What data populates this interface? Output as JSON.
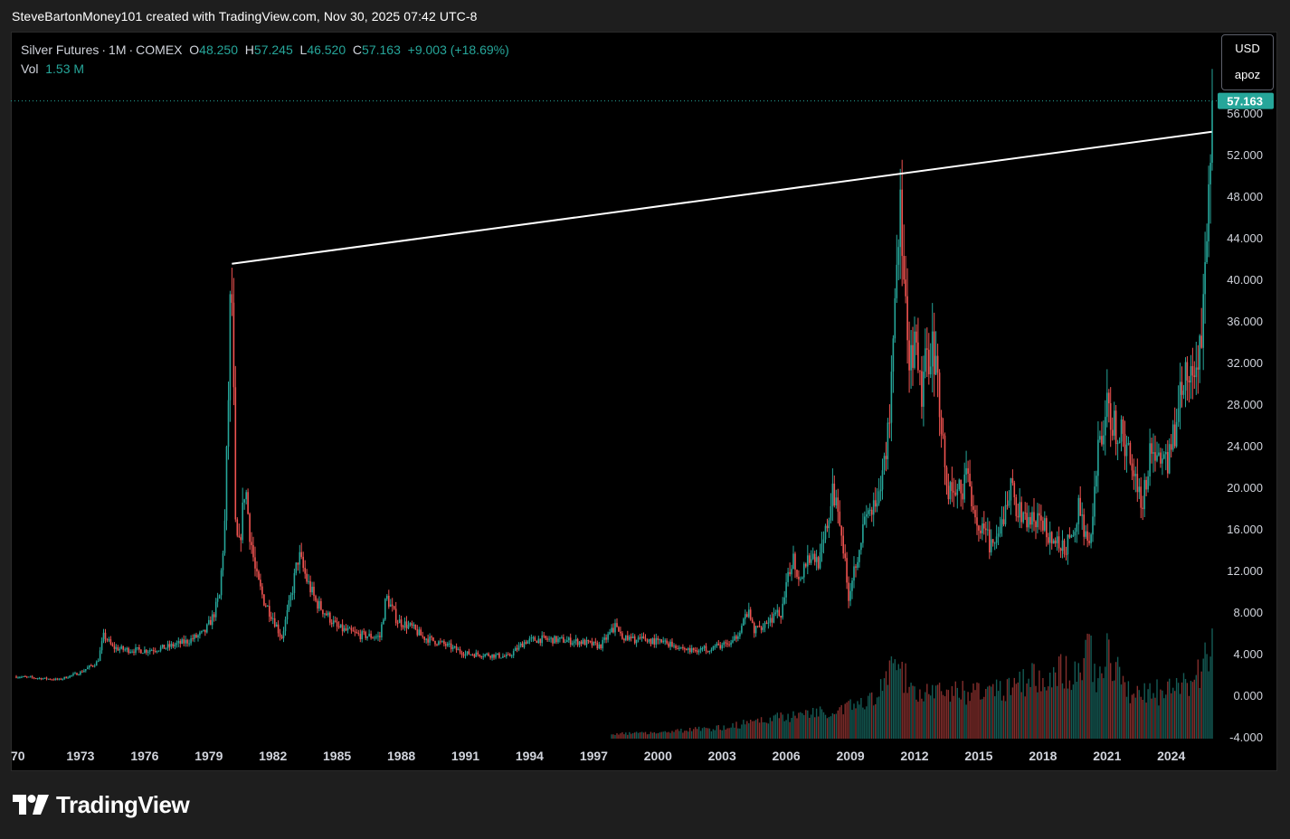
{
  "header": {
    "attribution": "SteveBartonMoney101 created with TradingView.com, Nov 30, 2025 07:42 UTC-8"
  },
  "legend": {
    "symbol": "Silver Futures",
    "interval": "1M",
    "exchange": "COMEX",
    "open_label": "O",
    "open": "48.250",
    "high_label": "H",
    "high": "57.245",
    "low_label": "L",
    "low": "46.520",
    "close_label": "C",
    "close": "57.163",
    "change": "+9.003",
    "change_pct": "(+18.69%)",
    "volume_label": "Vol",
    "volume": "1.53 M"
  },
  "price_scale": {
    "currency": "USD",
    "unit": "apoz",
    "last_price_label": "57.163"
  },
  "branding": {
    "logo_text": "TradingView"
  },
  "colors": {
    "up": "#26a69a",
    "down": "#ef5350",
    "background": "#000000",
    "trendline": "#ffffff",
    "axis_text": "#d1d4dc"
  },
  "chart_data": {
    "type": "candlestick",
    "interval": "1M",
    "y_ticks": [
      "-4.000",
      "0.000",
      "4.000",
      "8.000",
      "12.000",
      "16.000",
      "20.000",
      "24.000",
      "28.000",
      "32.000",
      "36.000",
      "40.000",
      "44.000",
      "48.000",
      "52.000",
      "56.000"
    ],
    "x_ticks": [
      "70",
      "1973",
      "1976",
      "1979",
      "1982",
      "1985",
      "1988",
      "1991",
      "1994",
      "1997",
      "2000",
      "2003",
      "2006",
      "2009",
      "2012",
      "2015",
      "2018",
      "2021",
      "2024"
    ],
    "ylim": [
      -4,
      60
    ],
    "xlim": [
      1970.0,
      2026.0
    ],
    "last_price": 57.163,
    "trendline": {
      "from": {
        "x": 1980.08,
        "y": 41.5
      },
      "to": {
        "x": 2025.9,
        "y": 54.2
      }
    },
    "price_path": [
      [
        1970.0,
        1.8
      ],
      [
        1972.0,
        1.5
      ],
      [
        1973.0,
        2.2
      ],
      [
        1973.8,
        3.2
      ],
      [
        1974.1,
        5.8
      ],
      [
        1974.5,
        4.6
      ],
      [
        1975.0,
        4.4
      ],
      [
        1976.0,
        4.3
      ],
      [
        1977.0,
        4.6
      ],
      [
        1978.0,
        5.2
      ],
      [
        1978.8,
        6.0
      ],
      [
        1979.2,
        7.6
      ],
      [
        1979.5,
        9.5
      ],
      [
        1979.75,
        16.5
      ],
      [
        1979.92,
        29.0
      ],
      [
        1980.04,
        41.0
      ],
      [
        1980.12,
        35.0
      ],
      [
        1980.25,
        16.0
      ],
      [
        1980.4,
        14.0
      ],
      [
        1980.55,
        16.8
      ],
      [
        1980.7,
        20.5
      ],
      [
        1980.9,
        16.0
      ],
      [
        1981.2,
        11.5
      ],
      [
        1981.6,
        9.0
      ],
      [
        1982.0,
        7.5
      ],
      [
        1982.4,
        5.5
      ],
      [
        1982.8,
        9.0
      ],
      [
        1983.2,
        13.5
      ],
      [
        1983.6,
        11.0
      ],
      [
        1984.0,
        9.0
      ],
      [
        1984.5,
        7.8
      ],
      [
        1985.0,
        6.5
      ],
      [
        1986.0,
        5.8
      ],
      [
        1987.0,
        5.6
      ],
      [
        1987.3,
        9.5
      ],
      [
        1987.8,
        7.2
      ],
      [
        1988.5,
        6.5
      ],
      [
        1989.0,
        5.6
      ],
      [
        1990.0,
        4.9
      ],
      [
        1991.0,
        4.0
      ],
      [
        1992.0,
        3.9
      ],
      [
        1993.0,
        3.7
      ],
      [
        1993.8,
        5.2
      ],
      [
        1994.5,
        5.4
      ],
      [
        1995.5,
        5.3
      ],
      [
        1996.5,
        5.1
      ],
      [
        1997.3,
        4.7
      ],
      [
        1998.0,
        6.6
      ],
      [
        1998.5,
        5.4
      ],
      [
        1999.5,
        5.3
      ],
      [
        2000.5,
        5.0
      ],
      [
        2001.5,
        4.3
      ],
      [
        2002.5,
        4.6
      ],
      [
        2003.5,
        5.0
      ],
      [
        2004.2,
        8.0
      ],
      [
        2004.5,
        6.2
      ],
      [
        2005.0,
        7.0
      ],
      [
        2005.8,
        8.0
      ],
      [
        2006.3,
        13.5
      ],
      [
        2006.6,
        11.2
      ],
      [
        2007.0,
        13.4
      ],
      [
        2007.6,
        13.0
      ],
      [
        2008.2,
        19.5
      ],
      [
        2008.5,
        17.5
      ],
      [
        2008.9,
        9.5
      ],
      [
        2009.3,
        13.5
      ],
      [
        2009.8,
        17.5
      ],
      [
        2010.3,
        18.0
      ],
      [
        2010.8,
        26.0
      ],
      [
        2011.3,
        48.0
      ],
      [
        2011.7,
        31.0
      ],
      [
        2012.0,
        33.0
      ],
      [
        2012.3,
        29.0
      ],
      [
        2012.8,
        34.5
      ],
      [
        2013.2,
        28.0
      ],
      [
        2013.5,
        20.0
      ],
      [
        2014.0,
        19.5
      ],
      [
        2014.5,
        21.0
      ],
      [
        2015.0,
        16.0
      ],
      [
        2015.8,
        14.0
      ],
      [
        2016.5,
        20.0
      ],
      [
        2017.0,
        17.0
      ],
      [
        2018.0,
        16.5
      ],
      [
        2018.8,
        14.0
      ],
      [
        2019.4,
        14.8
      ],
      [
        2019.7,
        18.5
      ],
      [
        2020.2,
        13.5
      ],
      [
        2020.6,
        24.0
      ],
      [
        2021.0,
        27.5
      ],
      [
        2021.5,
        25.5
      ],
      [
        2022.0,
        23.5
      ],
      [
        2022.7,
        18.5
      ],
      [
        2023.0,
        24.0
      ],
      [
        2023.5,
        22.5
      ],
      [
        2024.0,
        23.0
      ],
      [
        2024.4,
        29.5
      ],
      [
        2024.8,
        31.0
      ],
      [
        2025.0,
        29.5
      ],
      [
        2025.3,
        33.5
      ],
      [
        2025.5,
        36.5
      ],
      [
        2025.7,
        46.5
      ],
      [
        2025.8,
        48.5
      ],
      [
        2025.92,
        57.163
      ]
    ],
    "volume_profile": [
      [
        1997.8,
        0.05
      ],
      [
        2000.0,
        0.07
      ],
      [
        2003.0,
        0.12
      ],
      [
        2006.0,
        0.25
      ],
      [
        2008.0,
        0.3
      ],
      [
        2010.0,
        0.4
      ],
      [
        2011.0,
        0.75
      ],
      [
        2012.5,
        0.5
      ],
      [
        2014.0,
        0.5
      ],
      [
        2016.0,
        0.55
      ],
      [
        2017.5,
        0.65
      ],
      [
        2018.5,
        0.75
      ],
      [
        2019.5,
        0.7
      ],
      [
        2020.2,
        1.0
      ],
      [
        2020.5,
        0.65
      ],
      [
        2021.0,
        0.9
      ],
      [
        2022.0,
        0.55
      ],
      [
        2023.5,
        0.5
      ],
      [
        2024.5,
        0.6
      ],
      [
        2025.0,
        0.55
      ],
      [
        2025.9,
        1.0
      ]
    ]
  }
}
